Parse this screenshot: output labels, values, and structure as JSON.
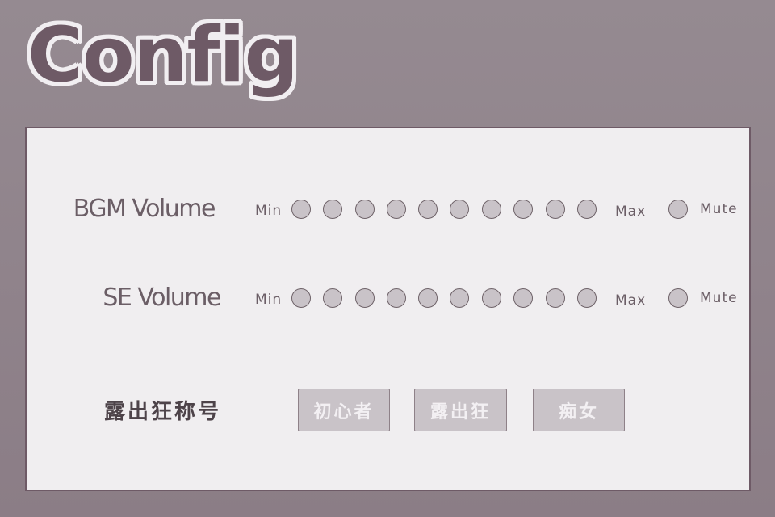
{
  "title": "Config",
  "bgm": {
    "label": "BGM Volume",
    "min_label": "Min",
    "max_label": "Max",
    "mute_label": "Mute",
    "level_count": 10
  },
  "se": {
    "label": "SE Volume",
    "min_label": "Min",
    "max_label": "Max",
    "mute_label": "Mute",
    "level_count": 10
  },
  "title_option": {
    "label": "露出狂称号",
    "options": [
      "初心者",
      "露出狂",
      "痴女"
    ]
  },
  "colors": {
    "background": "#8f838b",
    "panel": "#f0eef0",
    "dot_fill": "#c9c3c8",
    "text": "#6b5e66"
  }
}
